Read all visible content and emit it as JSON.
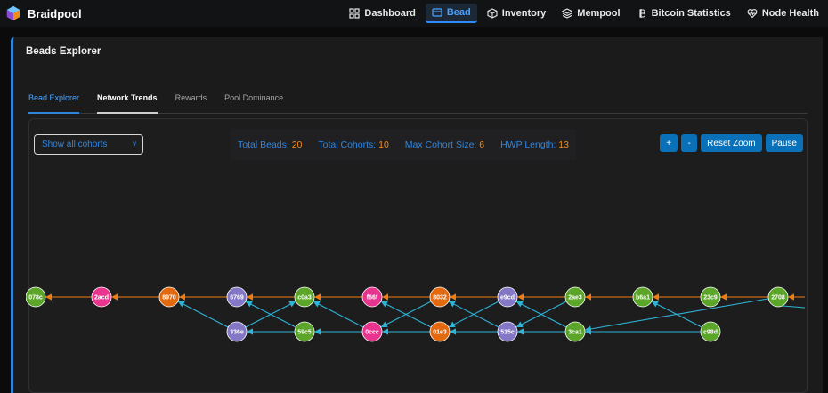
{
  "app": {
    "name": "Braidpool"
  },
  "nav": [
    {
      "label": "Dashboard",
      "icon": "grid-icon",
      "active": false
    },
    {
      "label": "Bead",
      "icon": "window-icon",
      "active": true
    },
    {
      "label": "Inventory",
      "icon": "cube-icon",
      "active": false
    },
    {
      "label": "Mempool",
      "icon": "layers-icon",
      "active": false
    },
    {
      "label": "Bitcoin Statistics",
      "icon": "bitcoin-icon",
      "active": false
    },
    {
      "label": "Node Health",
      "icon": "heart-pulse-icon",
      "active": false
    }
  ],
  "panel": {
    "title": "Beads Explorer"
  },
  "tabs": [
    "Bead Explorer",
    "Network Trends",
    "Rewards",
    "Pool Dominance"
  ],
  "filter": {
    "selected": "Show all cohorts"
  },
  "stats": [
    {
      "label": "Total Beads:",
      "value": "20"
    },
    {
      "label": "Total Cohorts:",
      "value": "10"
    },
    {
      "label": "Max Cohort Size:",
      "value": "6"
    },
    {
      "label": "HWP Length:",
      "value": "13"
    }
  ],
  "controls": {
    "zoom_in": "+",
    "zoom_out": "-",
    "reset": "Reset Zoom",
    "pause": "Pause"
  },
  "colors": {
    "accent": "#2f86d8",
    "hwp_edge": "#f07d12",
    "edge": "#2fb4d8",
    "green": "#5ba529",
    "pink": "#e8338f",
    "orange": "#e3690f",
    "purple": "#8477c6"
  },
  "graph": {
    "beads": [
      {
        "id": "078c",
        "color": "green"
      },
      {
        "id": "2acd",
        "color": "pink"
      },
      {
        "id": "8970",
        "color": "orange"
      },
      {
        "id": "6769",
        "color": "purple"
      },
      {
        "id": "336e",
        "color": "purple"
      },
      {
        "id": "c0a3",
        "color": "green"
      },
      {
        "id": "59c5",
        "color": "green"
      },
      {
        "id": "f66f",
        "color": "pink"
      },
      {
        "id": "0ccc",
        "color": "pink"
      },
      {
        "id": "8032",
        "color": "orange"
      },
      {
        "id": "01e3",
        "color": "orange"
      },
      {
        "id": "e9cd",
        "color": "purple"
      },
      {
        "id": "515c",
        "color": "purple"
      },
      {
        "id": "2ae3",
        "color": "green"
      },
      {
        "id": "3ca1",
        "color": "green"
      },
      {
        "id": "b6a1",
        "color": "green"
      },
      {
        "id": "23c9",
        "color": "green"
      },
      {
        "id": "c98d",
        "color": "green"
      },
      {
        "id": "2708",
        "color": "green"
      }
    ],
    "hwp": [
      "2708",
      "23c9",
      "b6a1",
      "2ae3",
      "e9cd",
      "8032",
      "f66f",
      "c0a3",
      "6769",
      "8970",
      "2acd",
      "078c"
    ],
    "links": [
      [
        "336e",
        "8970"
      ],
      [
        "336e",
        "c0a3"
      ],
      [
        "59c5",
        "6769"
      ],
      [
        "59c5",
        "336e"
      ],
      [
        "0ccc",
        "c0a3"
      ],
      [
        "0ccc",
        "59c5"
      ],
      [
        "01e3",
        "f66f"
      ],
      [
        "01e3",
        "0ccc"
      ],
      [
        "8032",
        "0ccc"
      ],
      [
        "515c",
        "8032"
      ],
      [
        "515c",
        "01e3"
      ],
      [
        "e9cd",
        "01e3"
      ],
      [
        "3ca1",
        "e9cd"
      ],
      [
        "3ca1",
        "515c"
      ],
      [
        "2ae3",
        "515c"
      ],
      [
        "c98d",
        "b6a1"
      ],
      [
        "c98d",
        "3ca1"
      ],
      [
        "2708",
        "3ca1"
      ]
    ]
  }
}
